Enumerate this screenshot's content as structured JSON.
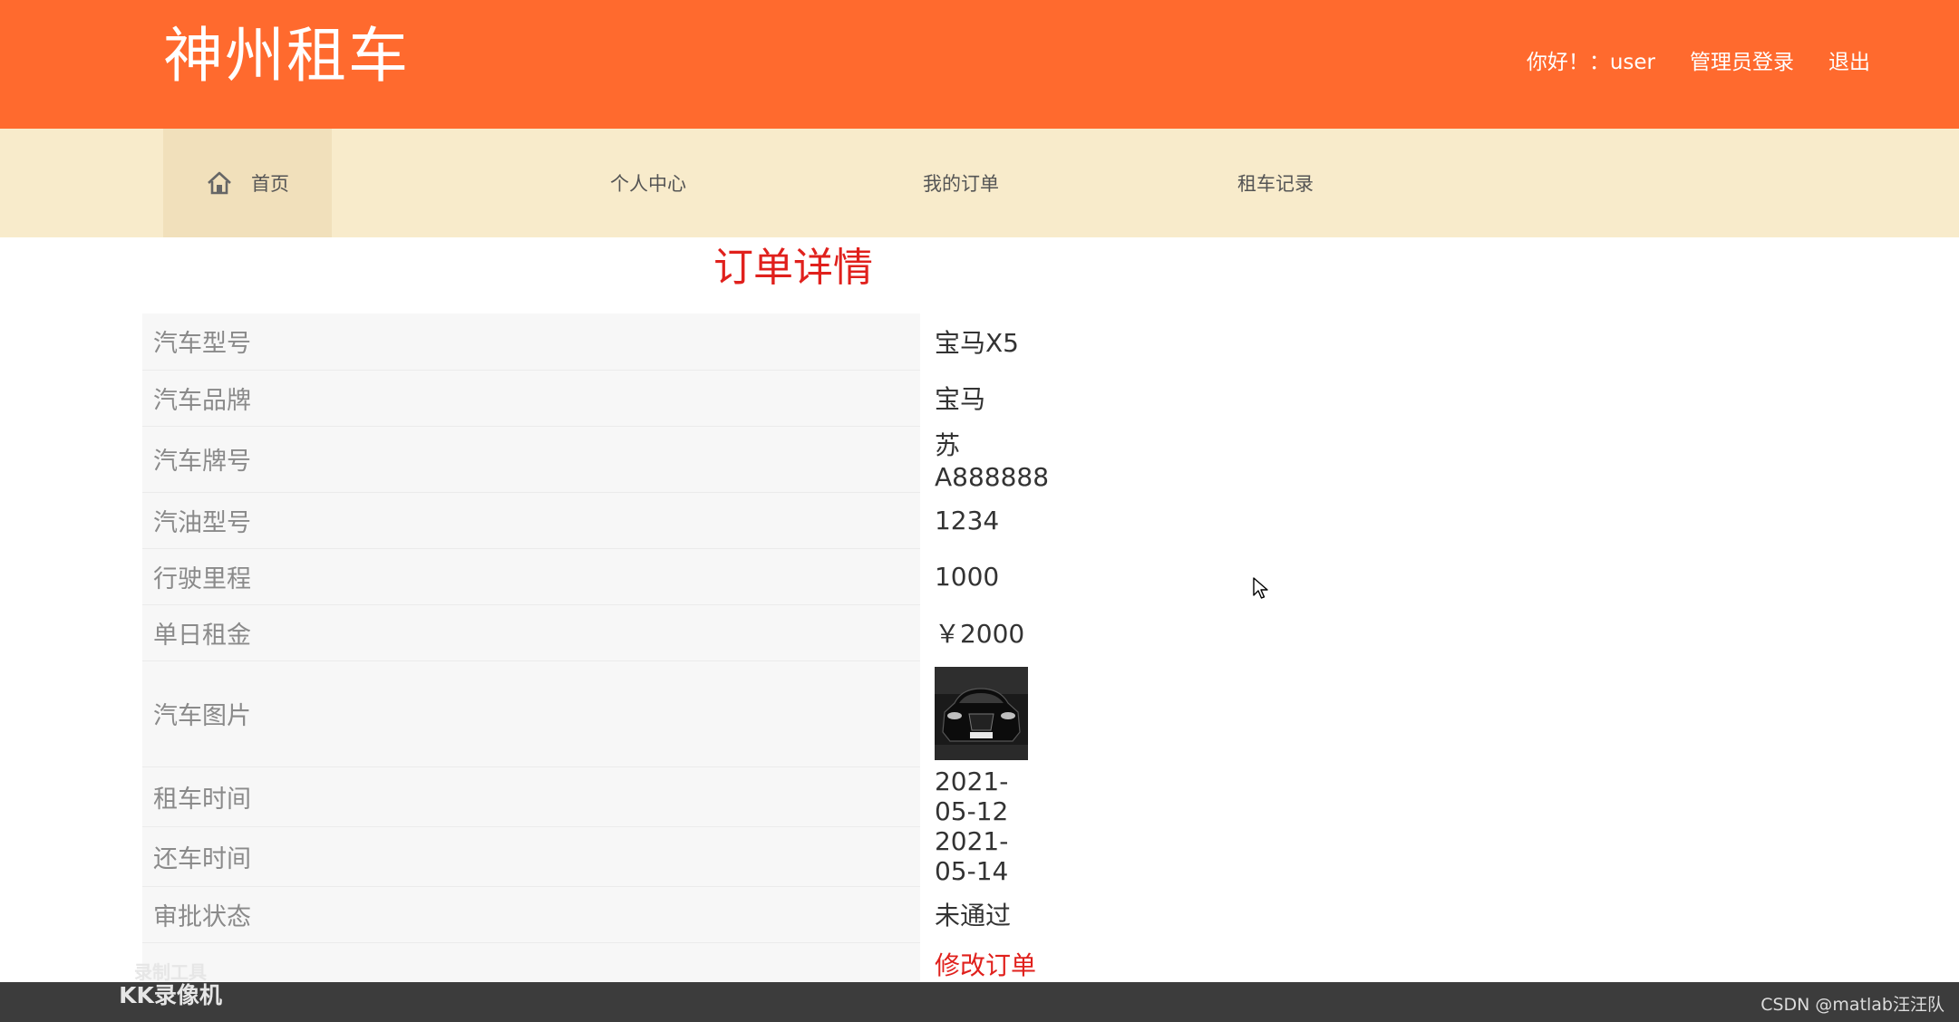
{
  "header": {
    "site_title": "神州租车",
    "greeting": "你好！：user",
    "admin_login": "管理员登录",
    "logout": "退出"
  },
  "nav": {
    "home": "首页",
    "profile": "个人中心",
    "orders": "我的订单",
    "records": "租车记录"
  },
  "page_title": "订单详情",
  "details": {
    "model_label": "汽车型号",
    "model_value": "宝马X5",
    "brand_label": "汽车品牌",
    "brand_value": "宝马",
    "plate_label": "汽车牌号",
    "plate_value": "苏A888888",
    "fuel_label": "汽油型号",
    "fuel_value": "1234",
    "mileage_label": "行驶里程",
    "mileage_value": "1000",
    "rent_label": "单日租金",
    "rent_value": "￥2000",
    "image_label": "汽车图片",
    "rent_date_label": "租车时间",
    "rent_date_value": "2021-05-12",
    "return_date_label": "还车时间",
    "return_date_value": "2021-05-14",
    "status_label": "审批状态",
    "status_value": "未通过",
    "edit_order": "修改订单"
  },
  "watermark": {
    "recorder_line1": "录制工具",
    "recorder_line2": "KK录像机",
    "csdn": "CSDN @matlab汪汪队"
  },
  "colors": {
    "header_bg": "#ff6a2e",
    "nav_bg": "#f8ebcb",
    "accent_red": "#e0201c"
  },
  "icons": {
    "home": "home-icon",
    "cursor": "mouse-pointer-icon",
    "car_image": "black-car-photo"
  }
}
